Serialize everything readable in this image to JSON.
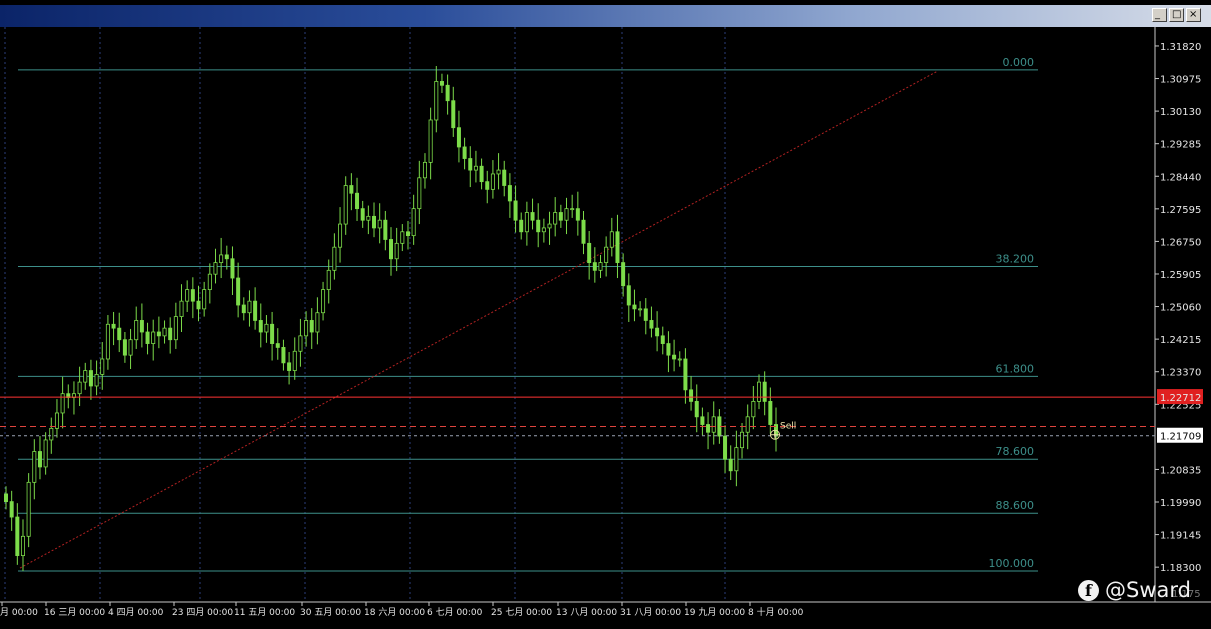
{
  "window": {
    "title": "",
    "buttons": [
      "minimize",
      "maximize",
      "close"
    ]
  },
  "price_axis": {
    "labels": [
      "1.31820",
      "1.30975",
      "1.30130",
      "1.29285",
      "1.28440",
      "1.27595",
      "1.26750",
      "1.25905",
      "1.25060",
      "1.24215",
      "1.23370",
      "1.22525",
      "1.20835",
      "1.19990",
      "1.19145",
      "1.18300"
    ],
    "red_price_label": "1.22712",
    "current_price_label": "1.21709",
    "bottom_label": "1.175"
  },
  "date_axis": {
    "labels": [
      "月 00:00",
      "16 三月 00:00",
      "4 四月 00:00",
      "23 四月 00:00",
      "11 五月 00:00",
      "30 五月 00:00",
      "18 六月 00:00",
      "6 七月 00:00",
      "25 七月 00:00",
      "13 八月 00:00",
      "31 八月 00:00",
      "19 九月 00:00",
      "8 十月 00:00"
    ]
  },
  "fibonacci": {
    "levels": [
      "0.000",
      "38.200",
      "61.800",
      "78.600",
      "88.600",
      "100.000"
    ]
  },
  "order": {
    "label": "Sell"
  },
  "watermark": {
    "icon": "facebook-icon",
    "icon_glyph": "f",
    "handle": "@Sward"
  },
  "colors": {
    "background": "#000000",
    "bull_candle": "#7ddc4a",
    "fib_line": "#3d8f8a",
    "trend_line": "#b22222",
    "price_line": "#ff3333",
    "grid": "#2b3e7a"
  },
  "chart_data": {
    "type": "candlestick",
    "y_range": [
      1.175,
      1.3226
    ],
    "fibonacci_prices": {
      "0.000": 1.312,
      "38.200": 1.261,
      "61.800": 1.2325,
      "78.600": 1.211,
      "88.600": 1.197,
      "100.000": 1.182
    },
    "red_price": 1.22712,
    "sell_price": 1.2195,
    "current_price": 1.21709,
    "closes": [
      1.2,
      1.196,
      1.186,
      1.191,
      1.205,
      1.213,
      1.209,
      1.216,
      1.219,
      1.223,
      1.228,
      1.227,
      1.228,
      1.231,
      1.234,
      1.23,
      1.233,
      1.237,
      1.246,
      1.245,
      1.242,
      1.238,
      1.242,
      1.247,
      1.244,
      1.241,
      1.244,
      1.243,
      1.245,
      1.242,
      1.248,
      1.252,
      1.255,
      1.252,
      1.25,
      1.255,
      1.259,
      1.262,
      1.264,
      1.263,
      1.258,
      1.251,
      1.249,
      1.252,
      1.247,
      1.244,
      1.246,
      1.241,
      1.24,
      1.236,
      1.234,
      1.239,
      1.243,
      1.247,
      1.244,
      1.249,
      1.255,
      1.26,
      1.266,
      1.272,
      1.282,
      1.28,
      1.276,
      1.273,
      1.274,
      1.271,
      1.273,
      1.268,
      1.263,
      1.267,
      1.27,
      1.269,
      1.276,
      1.284,
      1.288,
      1.299,
      1.309,
      1.308,
      1.304,
      1.297,
      1.292,
      1.289,
      1.286,
      1.287,
      1.283,
      1.281,
      1.285,
      1.286,
      1.282,
      1.278,
      1.273,
      1.27,
      1.275,
      1.273,
      1.27,
      1.271,
      1.272,
      1.275,
      1.273,
      1.276,
      1.276,
      1.273,
      1.267,
      1.262,
      1.26,
      1.262,
      1.266,
      1.27,
      1.262,
      1.256,
      1.251,
      1.25,
      1.25,
      1.247,
      1.245,
      1.243,
      1.241,
      1.238,
      1.237,
      1.237,
      1.229,
      1.226,
      1.222,
      1.22,
      1.218,
      1.222,
      1.217,
      1.211,
      1.208,
      1.214,
      1.218,
      1.222,
      1.226,
      1.231,
      1.226,
      1.22,
      1.217
    ]
  }
}
